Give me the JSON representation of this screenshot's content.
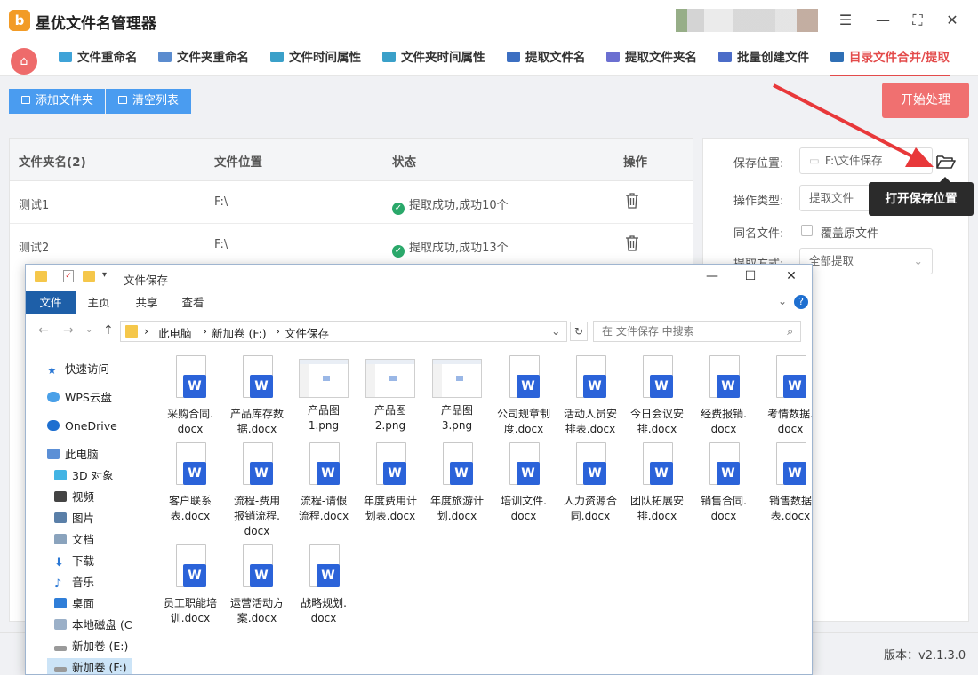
{
  "app": {
    "title": "星优文件名管理器",
    "logo_text": "b",
    "accent": "#e34b4b"
  },
  "tabs": [
    {
      "label": "文件重命名",
      "icon_color": "#3fa3d8"
    },
    {
      "label": "文件夹重命名",
      "icon_color": "#5b8ccf"
    },
    {
      "label": "文件时间属性",
      "icon_color": "#3aa0c9"
    },
    {
      "label": "文件夹时间属性",
      "icon_color": "#3aa0c9"
    },
    {
      "label": "提取文件名",
      "icon_color": "#3c6fc2"
    },
    {
      "label": "提取文件夹名",
      "icon_color": "#6b6fd1"
    },
    {
      "label": "批量创建文件",
      "icon_color": "#4b6cc8"
    },
    {
      "label": "目录文件合并/提取",
      "icon_color": "#2f6fb5"
    }
  ],
  "toolbar": {
    "add_folder": "添加文件夹",
    "clear_list": "清空列表",
    "start": "开始处理"
  },
  "table": {
    "headers": [
      "文件夹名(2)",
      "文件位置",
      "状态",
      "操作"
    ],
    "rows": [
      {
        "name": "测试1",
        "location": "F:\\",
        "status": "提取成功,成功10个"
      },
      {
        "name": "测试2",
        "location": "F:\\",
        "status": "提取成功,成功13个"
      }
    ]
  },
  "settings": {
    "save_label": "保存位置:",
    "save_value": "F:\\文件保存",
    "op_label": "操作类型:",
    "op_value": "提取文件",
    "same_label": "同名文件:",
    "same_option": "覆盖原文件",
    "mode_label": "提取方式:",
    "mode_value": "全部提取",
    "tooltip": "打开保存位置"
  },
  "footer": {
    "version": "版本：v2.1.3.0"
  },
  "explorer": {
    "title": "文件保存",
    "ribbon": [
      "文件",
      "主页",
      "共享",
      "查看"
    ],
    "breadcrumb": [
      "此电脑",
      "新加卷 (F:)",
      "文件保存"
    ],
    "search_placeholder": "在 文件保存 中搜索",
    "nav": [
      {
        "label": "快速访问",
        "icon": "star-icon"
      },
      {
        "label": "WPS云盘",
        "icon": "cloud-icon"
      },
      {
        "label": "OneDrive",
        "icon": "cloud-icon"
      },
      {
        "label": "此电脑",
        "icon": "computer-icon"
      },
      {
        "label": "3D 对象",
        "icon": "cube-icon"
      },
      {
        "label": "视频",
        "icon": "video-icon"
      },
      {
        "label": "图片",
        "icon": "picture-icon"
      },
      {
        "label": "文档",
        "icon": "document-icon"
      },
      {
        "label": "下载",
        "icon": "download-icon"
      },
      {
        "label": "音乐",
        "icon": "music-icon"
      },
      {
        "label": "桌面",
        "icon": "desktop-icon"
      },
      {
        "label": "本地磁盘 (C",
        "icon": "drive-icon"
      },
      {
        "label": "新加卷 (E:)",
        "icon": "drive-icon"
      },
      {
        "label": "新加卷 (F:)",
        "icon": "drive-icon"
      }
    ],
    "files": [
      {
        "l1": "采购合同.",
        "l2": "docx",
        "l3": "",
        "type": "docx"
      },
      {
        "l1": "产品库存数",
        "l2": "据.docx",
        "l3": "",
        "type": "docx"
      },
      {
        "l1": "产品图",
        "l2": "1.png",
        "l3": "",
        "type": "png"
      },
      {
        "l1": "产品图",
        "l2": "2.png",
        "l3": "",
        "type": "png"
      },
      {
        "l1": "产品图",
        "l2": "3.png",
        "l3": "",
        "type": "png"
      },
      {
        "l1": "公司规章制",
        "l2": "度.docx",
        "l3": "",
        "type": "docx"
      },
      {
        "l1": "活动人员安",
        "l2": "排表.docx",
        "l3": "",
        "type": "docx"
      },
      {
        "l1": "今日会议安",
        "l2": "排.docx",
        "l3": "",
        "type": "docx"
      },
      {
        "l1": "经费报销.",
        "l2": "docx",
        "l3": "",
        "type": "docx"
      },
      {
        "l1": "考情数据.",
        "l2": "docx",
        "l3": "",
        "type": "docx"
      },
      {
        "l1": "客户联系",
        "l2": "表.docx",
        "l3": "",
        "type": "docx"
      },
      {
        "l1": "流程-费用",
        "l2": "报销流程.",
        "l3": "docx",
        "type": "docx"
      },
      {
        "l1": "流程-请假",
        "l2": "流程.docx",
        "l3": "",
        "type": "docx"
      },
      {
        "l1": "年度费用计",
        "l2": "划表.docx",
        "l3": "",
        "type": "docx"
      },
      {
        "l1": "年度旅游计",
        "l2": "划.docx",
        "l3": "",
        "type": "docx"
      },
      {
        "l1": "培训文件.",
        "l2": "docx",
        "l3": "",
        "type": "docx"
      },
      {
        "l1": "人力资源合",
        "l2": "同.docx",
        "l3": "",
        "type": "docx"
      },
      {
        "l1": "团队拓展安",
        "l2": "排.docx",
        "l3": "",
        "type": "docx"
      },
      {
        "l1": "销售合同.",
        "l2": "docx",
        "l3": "",
        "type": "docx"
      },
      {
        "l1": "销售数据",
        "l2": "表.docx",
        "l3": "",
        "type": "docx"
      },
      {
        "l1": "员工职能培",
        "l2": "训.docx",
        "l3": "",
        "type": "docx"
      },
      {
        "l1": "运营活动方",
        "l2": "案.docx",
        "l3": "",
        "type": "docx"
      },
      {
        "l1": "战略规划.",
        "l2": "docx",
        "l3": "",
        "type": "docx"
      }
    ]
  }
}
